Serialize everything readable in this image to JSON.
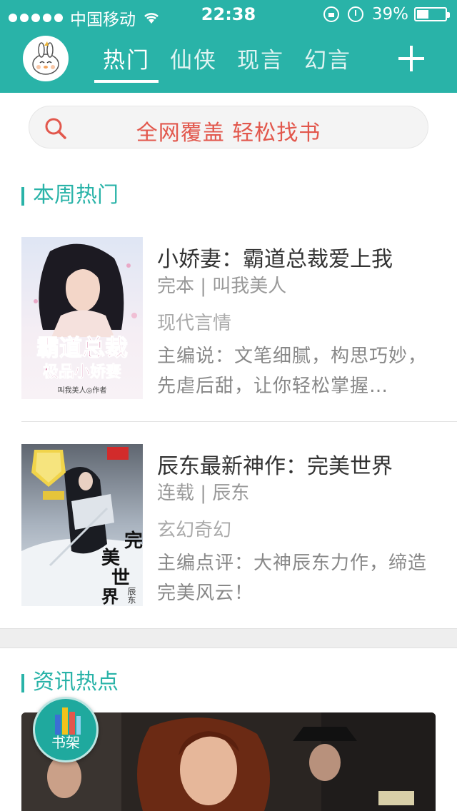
{
  "status_bar": {
    "carrier": "中国移动",
    "time": "22:38",
    "battery": "39%",
    "battery_level": 0.39
  },
  "nav": {
    "tabs": [
      {
        "label": "热门",
        "active": true
      },
      {
        "label": "仙侠",
        "active": false
      },
      {
        "label": "现言",
        "active": false
      },
      {
        "label": "幻言",
        "active": false
      }
    ]
  },
  "search": {
    "placeholder": "全网覆盖  轻松找书"
  },
  "weekly": {
    "heading": "本周热门",
    "books": [
      {
        "title": "小娇妻：霸道总裁爱上我",
        "meta": "完本 | 叫我美人",
        "category": "现代言情",
        "description": "主编说：文笔细腻，构思巧妙，先虐后甜，让你轻松掌握…",
        "cover_text": [
          "霸道总裁",
          "极品小娇妻",
          "叫我美人◎作者"
        ]
      },
      {
        "title": "辰东最新神作：完美世界",
        "meta": "连载 | 辰东",
        "category": "玄幻奇幻",
        "description": "主编点评：大神辰东力作，缔造完美风云！",
        "cover_text": [
          "完",
          "美",
          "世",
          "界",
          "辰东"
        ]
      }
    ]
  },
  "news": {
    "heading": "资讯热点"
  },
  "bookshelf": {
    "label": "书架"
  },
  "colors": {
    "accent": "#29b3a8",
    "search_text": "#e2574c"
  }
}
